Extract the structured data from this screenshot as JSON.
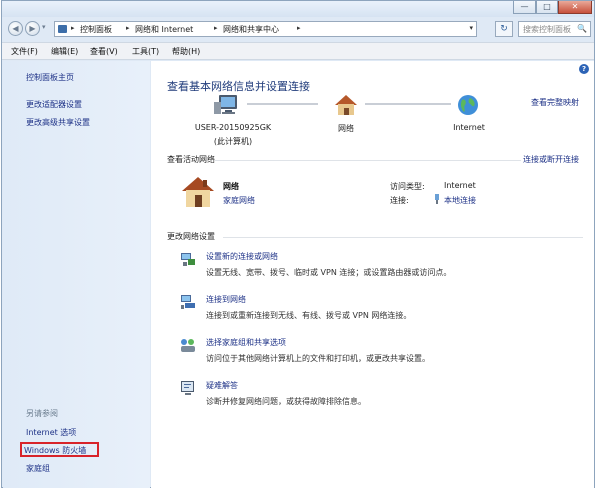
{
  "window": {
    "buttons": {
      "minimize": "—",
      "maximize": "□",
      "close": "✕"
    }
  },
  "address": {
    "crumbs": [
      "控制面板",
      "网络和 Internet",
      "网络和共享中心"
    ],
    "sep": "▸",
    "dropdown": "▾",
    "refresh": "↻",
    "search_placeholder": "搜索控制面板",
    "search_icon": "🔍"
  },
  "menu": {
    "file": "文件(F)",
    "edit": "编辑(E)",
    "view": "查看(V)",
    "tools": "工具(T)",
    "help": "帮助(H)"
  },
  "sidebar": {
    "home": "控制面板主页",
    "adapter": "更改适配器设置",
    "sharing": "更改高级共享设置",
    "see_also": "另请参阅",
    "internet_options": "Internet 选项",
    "firewall": "Windows 防火墙",
    "homegroup": "家庭组"
  },
  "main": {
    "help_icon": "?",
    "heading": "查看基本网络信息并设置连接",
    "view_full_map": "查看完整映射",
    "nodes": {
      "computer": "USER-20150925GK",
      "computer_sub": "(此计算机)",
      "network": "网络",
      "internet": "Internet"
    },
    "active_title": "查看活动网络",
    "connect_disconnect": "连接或断开连接",
    "active": {
      "name": "网络",
      "type": "家庭网络",
      "access_label": "访问类型:",
      "access_value": "Internet",
      "conn_label": "连接:",
      "conn_value": "本地连接"
    },
    "change_title": "更改网络设置",
    "tasks": [
      {
        "link": "设置新的连接或网络",
        "desc": "设置无线、宽带、拨号、临时或 VPN 连接；或设置路由器或访问点。"
      },
      {
        "link": "连接到网络",
        "desc": "连接到或重新连接到无线、有线、拨号或 VPN 网络连接。"
      },
      {
        "link": "选择家庭组和共享选项",
        "desc": "访问位于其他网络计算机上的文件和打印机，或更改共享设置。"
      },
      {
        "link": "疑难解答",
        "desc": "诊断并修复网络问题，或获得故障排除信息。"
      }
    ]
  },
  "colors": {
    "link": "#1e3287",
    "highlight_box": "#d8232a",
    "heading": "#1e3a7a"
  }
}
